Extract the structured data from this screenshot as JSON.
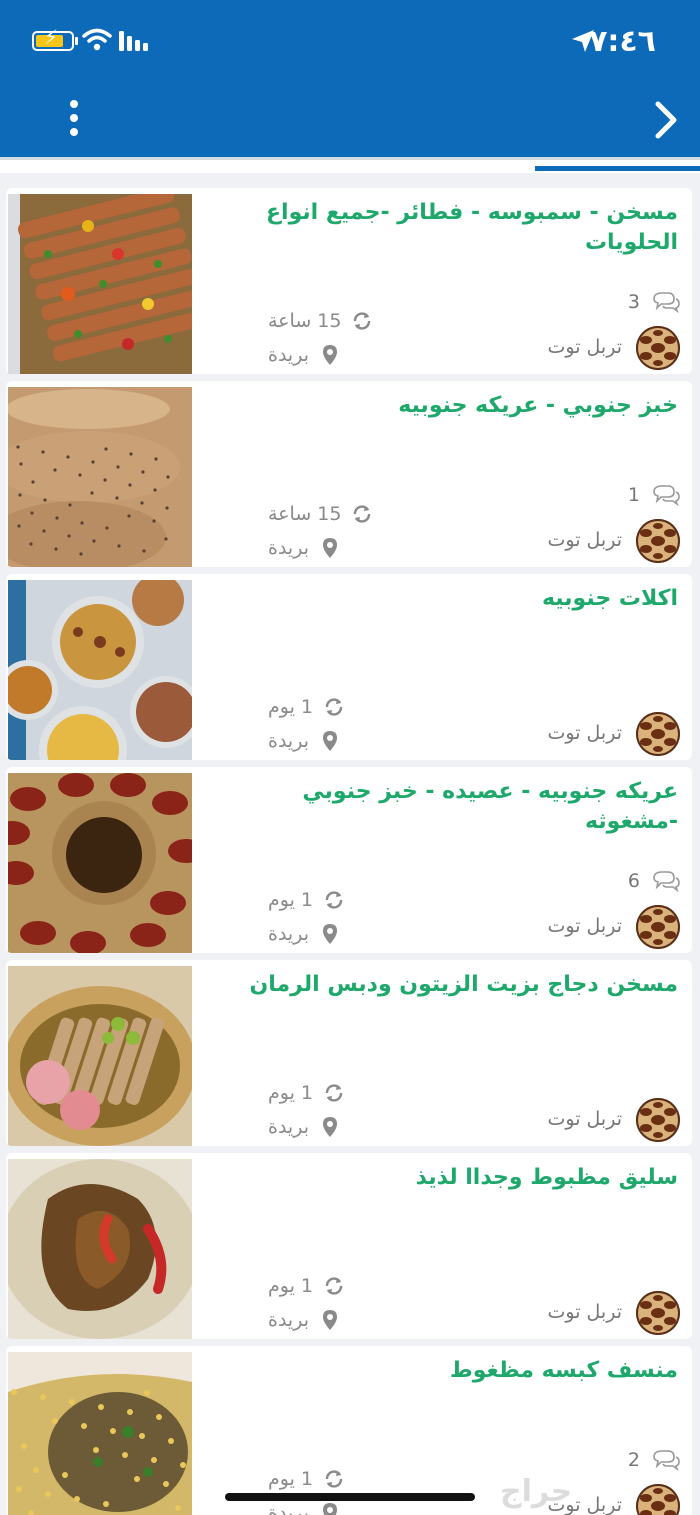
{
  "status_bar": {
    "time": "٧:٤٦",
    "battery_level": 0.75
  },
  "header": {
    "menu_icon": "more-vertical-icon",
    "back_icon": "chevron-right-icon",
    "background": "#0d6ab9"
  },
  "accent_colors": {
    "title": "#1ea86b",
    "brand": "#0d6ab9"
  },
  "listings": [
    {
      "title": "مسخن - سمبوسه - فطائر -جميع انواع الحلويات",
      "comments": "3",
      "author": "تربل توت",
      "time_ago": "15 ساعة",
      "city": "بريدة"
    },
    {
      "title": "خبز جنوبي - عريكه جنوبيه",
      "comments": "1",
      "author": "تربل توت",
      "time_ago": "15 ساعة",
      "city": "بريدة"
    },
    {
      "title": "اكلات جنوبيه",
      "comments": "",
      "author": "تربل توت",
      "time_ago": "1 يوم",
      "city": "بريدة"
    },
    {
      "title": "عريكه جنوبيه - عصيده - خبز جنوبي -مشغوثه",
      "comments": "6",
      "author": "تربل توت",
      "time_ago": "1 يوم",
      "city": "بريدة"
    },
    {
      "title": "مسخن دجاج بزيت الزيتون ودبس الرمان",
      "comments": "",
      "author": "تربل توت",
      "time_ago": "1 يوم",
      "city": "بريدة"
    },
    {
      "title": "سليق مظبوط وجداا لذيذ",
      "comments": "",
      "author": "تربل توت",
      "time_ago": "1 يوم",
      "city": "بريدة"
    },
    {
      "title": "منسف كبسه مظغوط",
      "comments": "2",
      "author": "تربل توت",
      "time_ago": "1 يوم",
      "city": "بريدة"
    }
  ],
  "watermark": "حراج"
}
